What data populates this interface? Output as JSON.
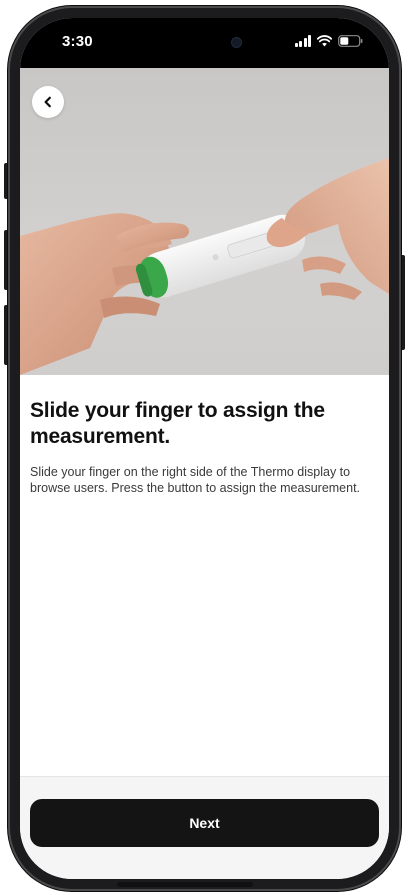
{
  "status_bar": {
    "time": "3:30",
    "icons": [
      "signal-icon",
      "wifi-icon",
      "battery-icon"
    ]
  },
  "hero": {
    "image": "hands-holding-thermo-device-photo",
    "back_icon": "chevron-left-icon"
  },
  "content": {
    "heading": "Slide your finger to assign the measurement.",
    "body": "Slide your finger on the right side of the Thermo display to browse users. Press the button to assign the measurement."
  },
  "footer": {
    "next_label": "Next"
  },
  "colors": {
    "primary_button": "#141414",
    "device_accent": "#3aa84a",
    "background": "#ffffff",
    "footer_background": "#f5f5f5"
  }
}
